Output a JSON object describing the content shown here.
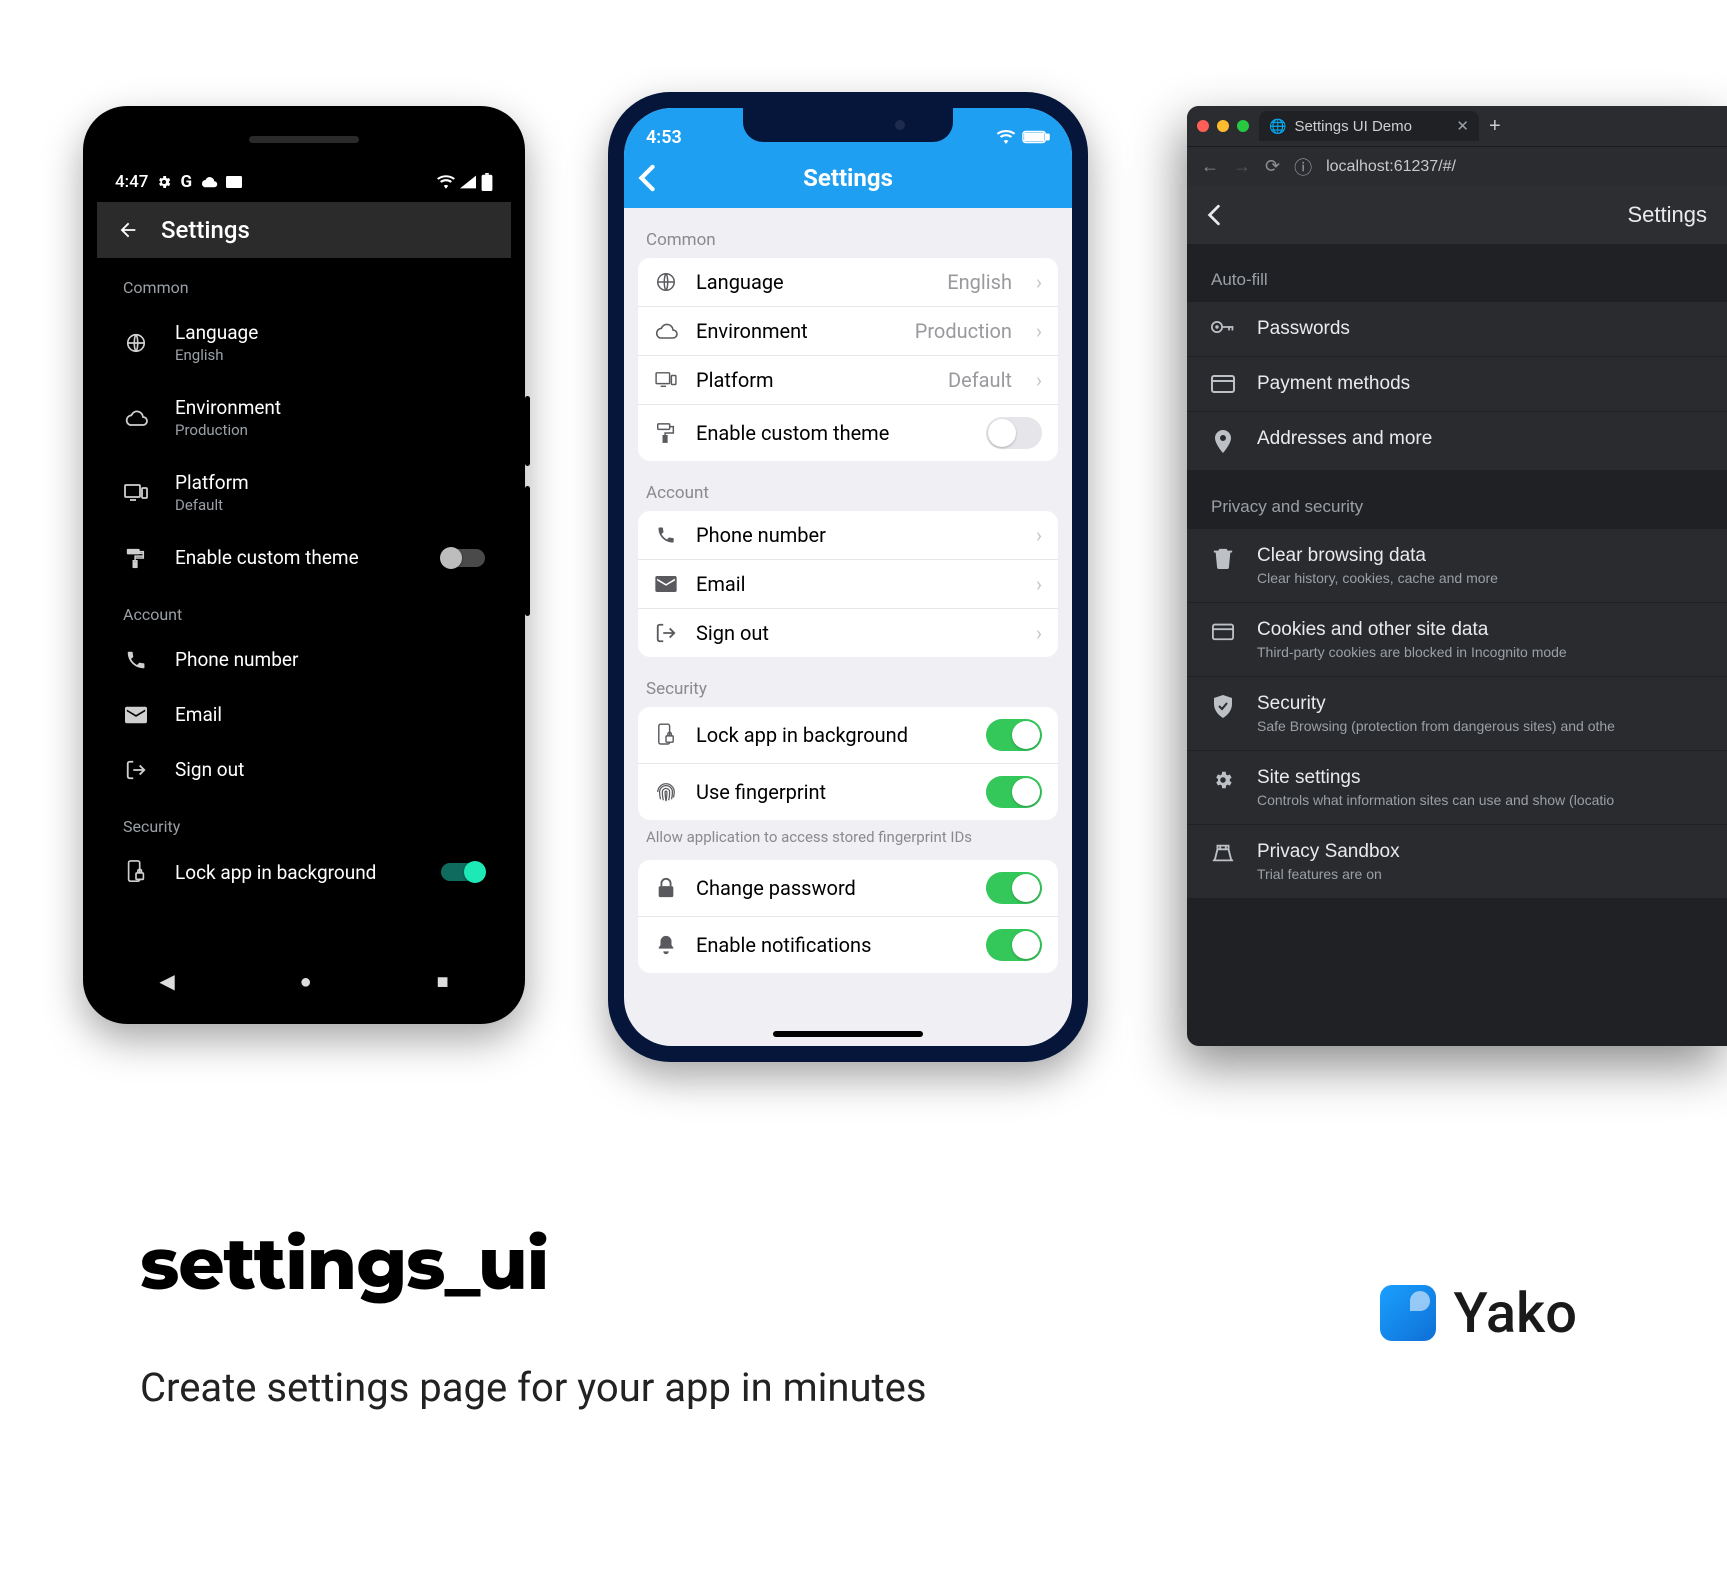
{
  "android": {
    "status_time": "4:47",
    "appbar_title": "Settings",
    "sections": {
      "common": "Common",
      "account": "Account",
      "security": "Security"
    },
    "language_label": "Language",
    "language_value": "English",
    "environment_label": "Environment",
    "environment_value": "Production",
    "platform_label": "Platform",
    "platform_value": "Default",
    "custom_theme_label": "Enable custom theme",
    "phone_label": "Phone number",
    "email_label": "Email",
    "signout_label": "Sign out",
    "lock_bg_label": "Lock app in background"
  },
  "ios": {
    "status_time": "4:53",
    "appbar_title": "Settings",
    "sections": {
      "common": "Common",
      "account": "Account",
      "security": "Security"
    },
    "language_label": "Language",
    "language_value": "English",
    "environment_label": "Environment",
    "environment_value": "Production",
    "platform_label": "Platform",
    "platform_value": "Default",
    "custom_theme_label": "Enable custom theme",
    "phone_label": "Phone number",
    "email_label": "Email",
    "signout_label": "Sign out",
    "lock_bg_label": "Lock app in background",
    "fingerprint_label": "Use fingerprint",
    "fingerprint_note": "Allow application to access stored fingerprint IDs",
    "change_password_label": "Change password",
    "notifications_label": "Enable notifications"
  },
  "web": {
    "tab_title": "Settings UI Demo",
    "url": "localhost:61237/#/",
    "appbar_title": "Settings",
    "sections": {
      "autofill": "Auto-fill",
      "privacy": "Privacy and security"
    },
    "passwords_label": "Passwords",
    "payment_label": "Payment methods",
    "addresses_label": "Addresses and more",
    "clear_label": "Clear browsing data",
    "clear_sub": "Clear history, cookies, cache and more",
    "cookies_label": "Cookies and other site data",
    "cookies_sub": "Third-party cookies are blocked in Incognito mode",
    "security_label": "Security",
    "security_sub": "Safe Browsing (protection from dangerous sites) and othe",
    "site_label": "Site settings",
    "site_sub": "Controls what information sites can use and show (locatio",
    "sandbox_label": "Privacy Sandbox",
    "sandbox_sub": "Trial features are on"
  },
  "hero": {
    "title": "settings_ui",
    "subtitle": "Create settings page for your app in minutes",
    "brand": "Yako"
  }
}
